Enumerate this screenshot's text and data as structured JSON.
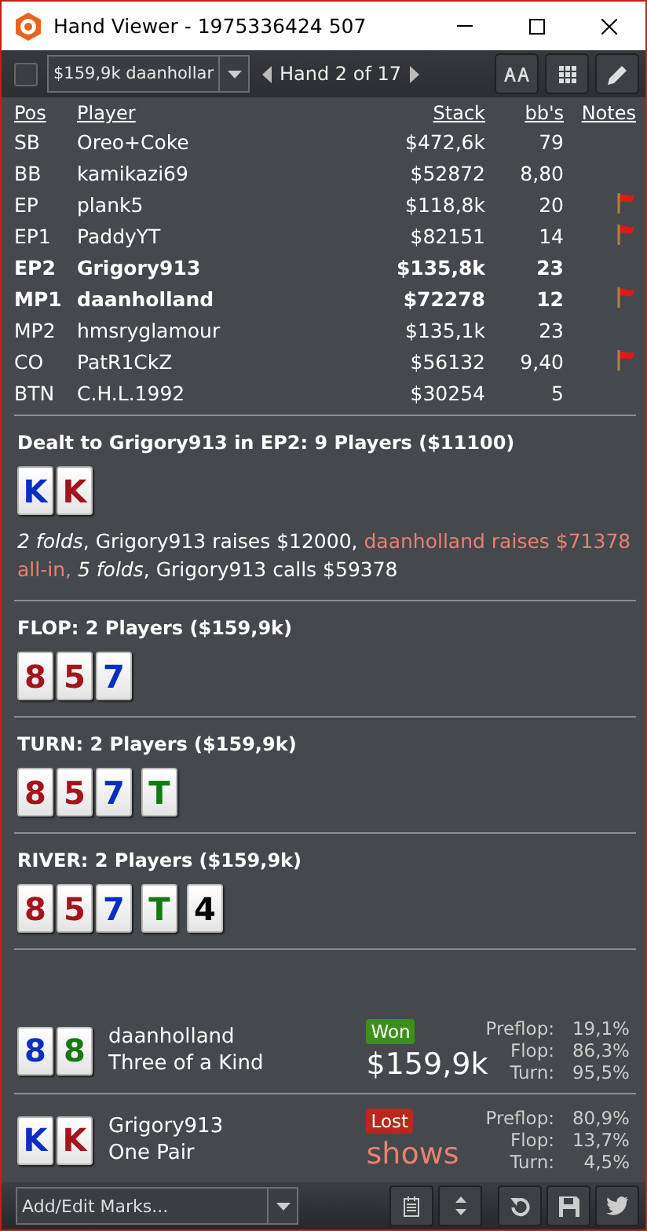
{
  "window": {
    "title": "Hand Viewer - 1975336424 507"
  },
  "toolbar": {
    "checked": false,
    "hand_select": "$159,9k daanhollar",
    "hand_label": "Hand 2 of 17"
  },
  "table": {
    "columns": [
      "Pos",
      "Player",
      "Stack",
      "bb's",
      "Notes"
    ],
    "rows": [
      {
        "pos": "SB",
        "player": "Oreo+Coke",
        "stack": "$472,6k",
        "bbs": "79",
        "note": false,
        "bold": false
      },
      {
        "pos": "BB",
        "player": "kamikazi69",
        "stack": "$52872",
        "bbs": "8,80",
        "note": false,
        "bold": false
      },
      {
        "pos": "EP",
        "player": "plank5",
        "stack": "$118,8k",
        "bbs": "20",
        "note": true,
        "bold": false
      },
      {
        "pos": "EP1",
        "player": "PaddyYT",
        "stack": "$82151",
        "bbs": "14",
        "note": true,
        "bold": false
      },
      {
        "pos": "EP2",
        "player": "Grigory913",
        "stack": "$135,8k",
        "bbs": "23",
        "note": false,
        "bold": true
      },
      {
        "pos": "MP1",
        "player": "daanholland",
        "stack": "$72278",
        "bbs": "12",
        "note": true,
        "bold": true
      },
      {
        "pos": "MP2",
        "player": "hmsryglamour",
        "stack": "$135,1k",
        "bbs": "23",
        "note": false,
        "bold": false
      },
      {
        "pos": "CO",
        "player": "PatR1CkZ",
        "stack": "$56132",
        "bbs": "9,40",
        "note": true,
        "bold": false
      },
      {
        "pos": "BTN",
        "player": "C.H.L.1992",
        "stack": "$30254",
        "bbs": "5",
        "note": false,
        "bold": false
      }
    ]
  },
  "streets": [
    {
      "title": "Dealt to Grigory913 in EP2: 9 Players ($11100)",
      "cards": [
        {
          "rank": "K",
          "color": "#0a2fc0"
        },
        {
          "rank": "K",
          "color": "#a3141c"
        }
      ],
      "actions": [
        {
          "kind": "fold",
          "text": "2 folds"
        },
        {
          "kind": "plain",
          "text": ", Grigory913 raises $12000, "
        },
        {
          "kind": "hero",
          "text": "daanholland raises $71378 all-in, "
        },
        {
          "kind": "fold",
          "text": "5 folds"
        },
        {
          "kind": "plain",
          "text": ", Grigory913 calls $59378"
        }
      ]
    },
    {
      "title": "FLOP: 2 Players ($159,9k)",
      "cards": [
        {
          "rank": "8",
          "color": "#a3141c"
        },
        {
          "rank": "5",
          "color": "#a3141c"
        },
        {
          "rank": "7",
          "color": "#0a2fc0"
        }
      ]
    },
    {
      "title": "TURN: 2 Players ($159,9k)",
      "cards": [
        {
          "rank": "8",
          "color": "#a3141c"
        },
        {
          "rank": "5",
          "color": "#a3141c"
        },
        {
          "rank": "7",
          "color": "#0a2fc0"
        },
        {
          "rank": "T",
          "color": "#137a13"
        }
      ]
    },
    {
      "title": "RIVER: 2 Players ($159,9k)",
      "cards": [
        {
          "rank": "8",
          "color": "#a3141c"
        },
        {
          "rank": "5",
          "color": "#a3141c"
        },
        {
          "rank": "7",
          "color": "#0a2fc0"
        },
        {
          "rank": "T",
          "color": "#137a13"
        },
        {
          "rank": "4",
          "color": "#000000"
        }
      ]
    }
  ],
  "results": [
    {
      "cards": [
        {
          "rank": "8",
          "color": "#0a2fc0"
        },
        {
          "rank": "8",
          "color": "#137a13"
        }
      ],
      "player": "daanholland",
      "hand": "Three of a Kind",
      "kind": "won",
      "badge": "Won",
      "amount": "$159,9k",
      "equity": [
        {
          "label": "Preflop:",
          "value": "19,1%"
        },
        {
          "label": "Flop:",
          "value": "86,3%"
        },
        {
          "label": "Turn:",
          "value": "95,5%"
        }
      ]
    },
    {
      "cards": [
        {
          "rank": "K",
          "color": "#0a2fc0"
        },
        {
          "rank": "K",
          "color": "#a3141c"
        }
      ],
      "player": "Grigory913",
      "hand": "One Pair",
      "kind": "lost",
      "badge": "Lost",
      "amount": "shows",
      "equity": [
        {
          "label": "Preflop:",
          "value": "80,9%"
        },
        {
          "label": "Flop:",
          "value": "13,7%"
        },
        {
          "label": "Turn:",
          "value": "4,5%"
        }
      ]
    }
  ],
  "footer": {
    "marks_select": "Add/Edit Marks..."
  }
}
